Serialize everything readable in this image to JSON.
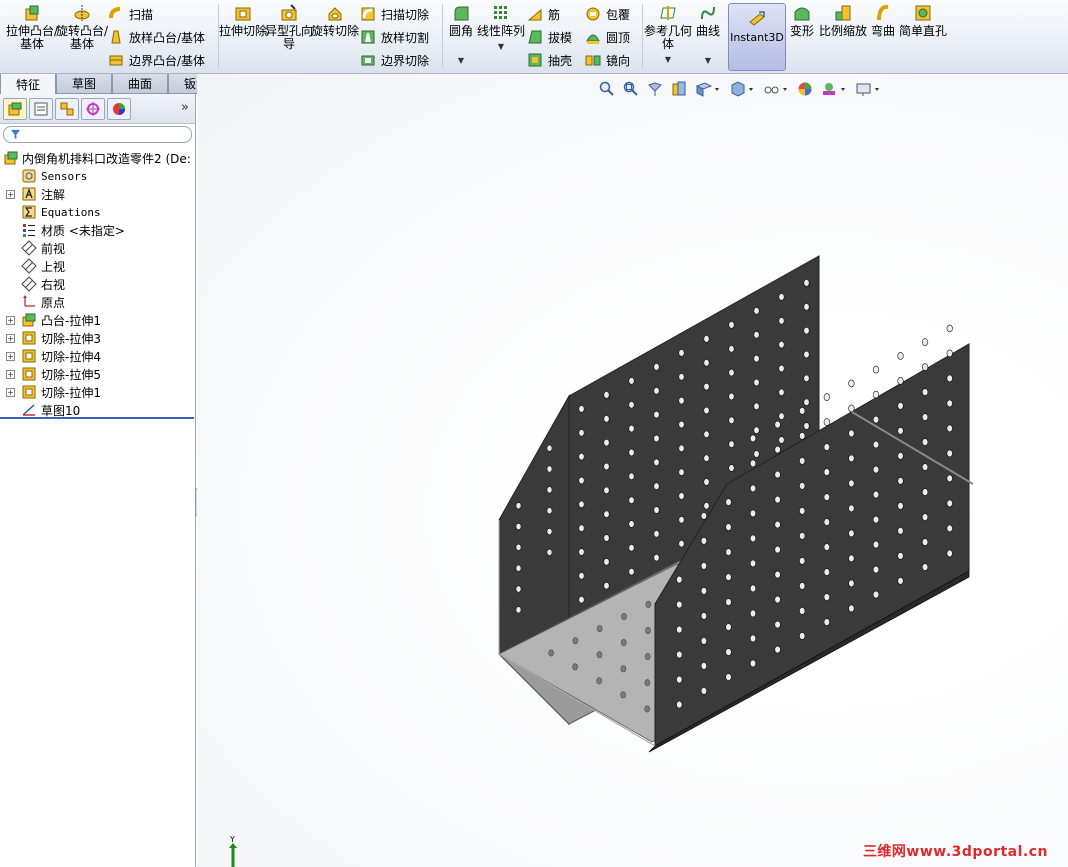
{
  "ribbon": {
    "large_buttons": [
      {
        "id": "extrude-boss",
        "label": "拉伸凸台/基体",
        "icon": "extrude-boss-icon"
      },
      {
        "id": "revolve-boss",
        "label": "旋转凸台/基体",
        "icon": "revolve-boss-icon"
      }
    ],
    "boss_small": [
      "扫描",
      "放样凸台/基体",
      "边界凸台/基体"
    ],
    "cut_large": [
      {
        "id": "extrude-cut",
        "label": "拉伸切除",
        "icon": "extrude-cut-icon"
      },
      {
        "id": "hole-wizard",
        "label": "异型孔向导",
        "icon": "hole-wizard-icon"
      },
      {
        "id": "revolve-cut",
        "label": "旋转切除",
        "icon": "revolve-cut-icon"
      }
    ],
    "cut_small": [
      "扫描切除",
      "放样切割",
      "边界切除"
    ],
    "features_large": [
      {
        "id": "fillet",
        "label": "圆角",
        "icon": "fillet-icon"
      },
      {
        "id": "linear-pattern",
        "label": "线性阵列",
        "icon": "linear-pattern-icon"
      }
    ],
    "features_small_col1": [
      "筋",
      "拔模",
      "抽壳"
    ],
    "features_small_col2": [
      "包覆",
      "圆顶",
      "镜向"
    ],
    "right_large": [
      {
        "id": "ref-geometry",
        "label": "参考几何体",
        "icon": "reference-geometry-icon"
      },
      {
        "id": "curves",
        "label": "曲线",
        "icon": "curves-icon"
      },
      {
        "id": "instant3d",
        "label": "Instant3D",
        "icon": "instant3d-icon"
      },
      {
        "id": "deform",
        "label": "变形",
        "icon": "deform-icon"
      },
      {
        "id": "scale",
        "label": "比例缩放",
        "icon": "scale-icon"
      },
      {
        "id": "flex",
        "label": "弯曲",
        "icon": "flex-icon"
      },
      {
        "id": "simple-hole",
        "label": "简单直孔",
        "icon": "simple-hole-icon"
      }
    ]
  },
  "tabs": [
    "特征",
    "草图",
    "曲面",
    "钣金"
  ],
  "active_tab": "特征",
  "tree": {
    "root": "内倒角机排料口改造零件2 (De:",
    "items": [
      {
        "label": "Sensors",
        "icon": "sensors-icon",
        "expand": false,
        "mono": true
      },
      {
        "label": "注解",
        "icon": "annotations-icon",
        "expand": true,
        "mono": false
      },
      {
        "label": "Equations",
        "icon": "equations-icon",
        "expand": false,
        "mono": true
      },
      {
        "label": "材质 <未指定>",
        "icon": "material-icon",
        "expand": false,
        "mono": false
      },
      {
        "label": "前视",
        "icon": "plane-icon",
        "expand": false,
        "mono": false
      },
      {
        "label": "上视",
        "icon": "plane-icon",
        "expand": false,
        "mono": false
      },
      {
        "label": "右视",
        "icon": "plane-icon",
        "expand": false,
        "mono": false
      },
      {
        "label": "原点",
        "icon": "origin-icon",
        "expand": false,
        "mono": false
      },
      {
        "label": "凸台-拉伸1",
        "icon": "boss-extrude-icon",
        "expand": true,
        "mono": false
      },
      {
        "label": "切除-拉伸3",
        "icon": "cut-extrude-icon",
        "expand": true,
        "mono": false
      },
      {
        "label": "切除-拉伸4",
        "icon": "cut-extrude-icon",
        "expand": true,
        "mono": false
      },
      {
        "label": "切除-拉伸5",
        "icon": "cut-extrude-icon",
        "expand": true,
        "mono": false
      },
      {
        "label": "切除-拉伸1",
        "icon": "cut-extrude-icon",
        "expand": true,
        "mono": false
      },
      {
        "label": "草图10",
        "icon": "sketch-icon",
        "expand": false,
        "mono": false
      }
    ]
  },
  "viewport": {
    "triad_axis": "Y",
    "watermark": "三维网www.3dportal.cn"
  },
  "colors": {
    "accent": "#3566b8",
    "sheet_dark": "#3a3a3a",
    "sheet_light": "#9b9b9b",
    "watermark": "#e02a2a"
  }
}
